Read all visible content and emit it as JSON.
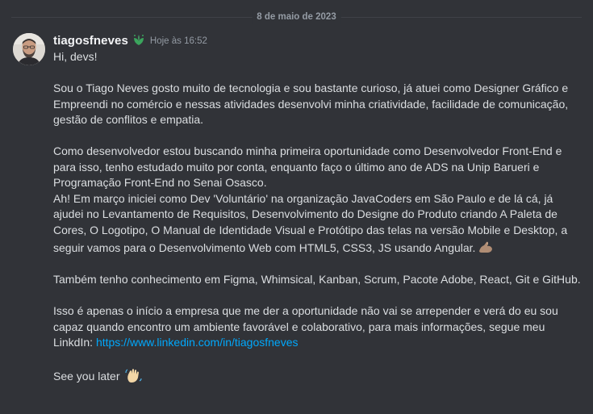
{
  "date_divider": "8 de maio de 2023",
  "message": {
    "username": "tiagosfneves",
    "badge_icon": "nitro-leaf-badge-icon",
    "timestamp": "Hoje às 16:52",
    "line_greeting": "Hi, devs!",
    "para1": "Sou o Tiago Neves gosto muito de tecnologia e sou bastante curioso, já atuei como Designer Gráfico e Empreendi no comércio e nessas atividades desenvolvi minha criatividade, facilidade de comunicação, gestão de conflitos e empatia.",
    "para2a": "Como desenvolvedor estou buscando minha primeira oportunidade como Desenvolvedor Front-End e para isso, tenho estudado muito por conta, enquanto faço o último ano de ADS na Unip Barueri e Programação Front-End no Senai Osasco.",
    "para2b": "Ah! Em março iniciei como Dev 'Voluntário' na organização JavaCoders em São Paulo e de lá cá, já ajudei no Levantamento de Requisitos, Desenvolvimento do Designe do Produto criando A Paleta de Cores, O Logotipo, O Manual de Identidade Visual e Protótipo das telas na versão Mobile e Desktop, a seguir vamos para o Desenvolvimento Web com HTML5, CSS3, JS usando Angular.",
    "para2b_emoji": "muscle-emoji",
    "para3": "Também tenho conhecimento em Figma, Whimsical, Kanban, Scrum, Pacote Adobe, React, Git e GitHub.",
    "para4": "Isso é apenas o início a empresa que me der a oportunidade não vai se arrepender e verá do eu sou capaz quando encontro um ambiente favorável e colaborativo, para mais informações, segue meu LinkdIn: ",
    "link": "https://www.linkedin.com/in/tiagosfneves",
    "closing": "See you later",
    "closing_emoji": "waving-hand-emoji"
  }
}
